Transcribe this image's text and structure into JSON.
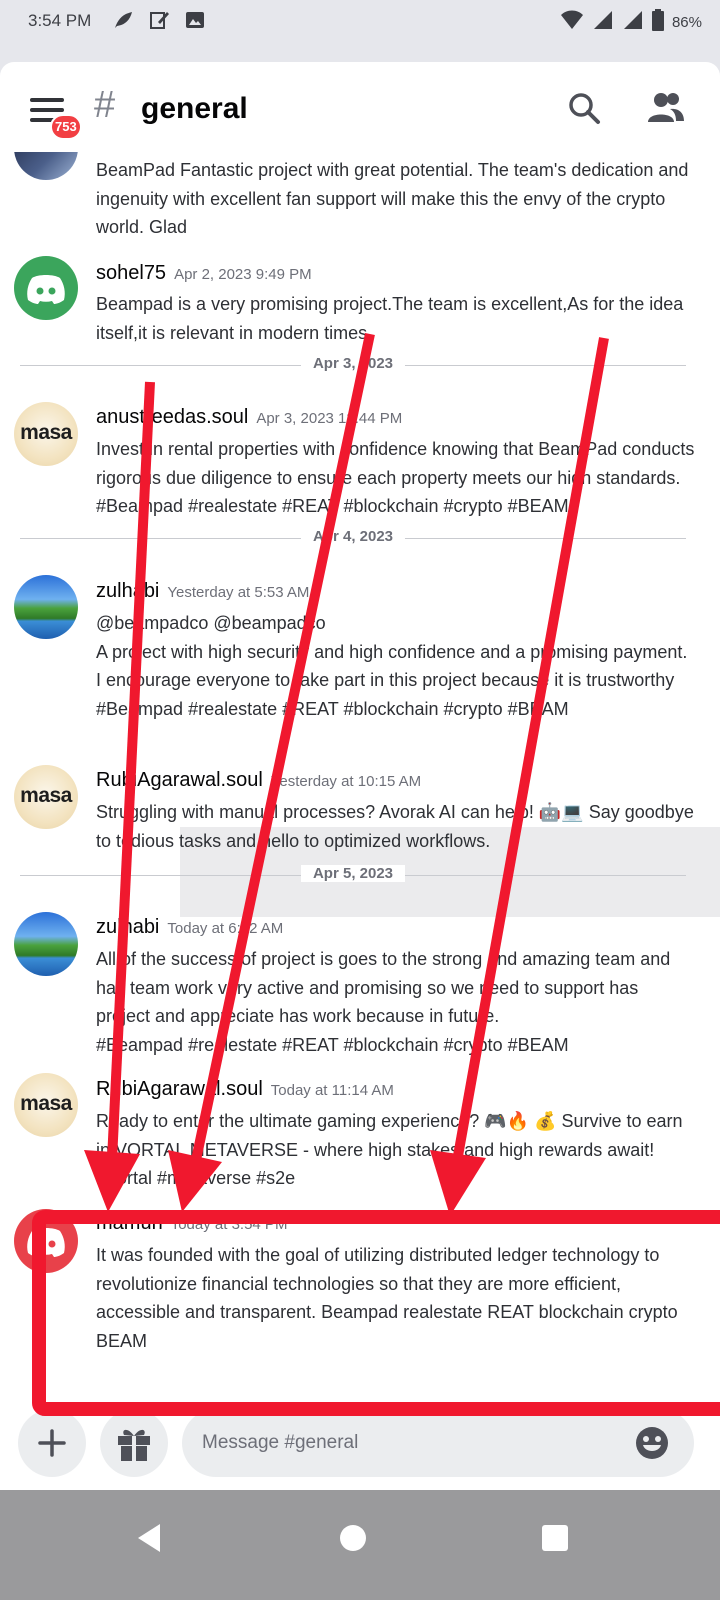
{
  "status_bar": {
    "time": "3:54 PM",
    "battery": "86%"
  },
  "header": {
    "badge_count": "753",
    "hash_symbol": "#",
    "channel_name": "general"
  },
  "messages": [
    {
      "body": "BeamPad Fantastic project with great potential. The team's dedication and ingenuity with excellent fan support will make this the envy of the crypto world. Glad"
    },
    {
      "author": "sohel75",
      "timestamp": "Apr 2, 2023 9:49 PM",
      "body": "Beampad is a very promising project.The team is excellent,As for the idea itself,it is relevant in modern times."
    },
    {
      "author": "anustreedas.soul",
      "timestamp": "Apr 3, 2023 12:44 PM",
      "body": "Invest in rental properties with confidence knowing that BeamPad conducts rigorous due diligence to ensure each property meets our high standards. #Beampad #realestate #REAT #blockchain #crypto #BEAM"
    },
    {
      "author": "zulhabi",
      "timestamp": "Yesterday at 5:53 AM",
      "body": "@beampadco @beampadco\nA project with high security and high confidence and a promising payment. I encourage everyone to take part in this project because it is trustworthy\n #Beampad #realestate #REAT #blockchain #crypto #BEAM"
    },
    {
      "author": "RubiAgarawal.soul",
      "timestamp": "Yesterday at 10:15 AM",
      "body": "Struggling with manual processes? Avorak AI can help! 🤖💻 Say goodbye to tedious tasks and hello to optimized workflows."
    },
    {
      "author": "zulhabi",
      "timestamp": "Today at 6:02 AM",
      "body": "All of the success of project is goes to the strong and amazing team and has team work very active and promising so we need to support has project and appreciate has work because in future.\n#Beampad #realestate #REAT #blockchain #crypto #BEAM"
    },
    {
      "author": "RubiAgarawal.soul",
      "timestamp": "Today at 11:14 AM",
      "body": "Ready to enter the ultimate gaming experience? 🎮🔥 💰 Survive to earn in VORTAL METAVERSE - where high stakes and high rewards await! #Vortal #metaverse #s2e"
    },
    {
      "author": "mamun",
      "timestamp": "Today at 3:54 PM",
      "body": "It was founded with the goal of utilizing distributed ledger technology to revolutionize financial technologies so that they are more efficient, accessible and transparent. Beampad realestate REAT blockchain crypto BEAM"
    }
  ],
  "dividers": [
    "Apr 3, 2023",
    "Apr 4, 2023",
    "Apr 5, 2023"
  ],
  "avatar_text": "masa",
  "composer": {
    "placeholder": "Message #general"
  },
  "colors": {
    "annotation_red": "#f0182e",
    "discord_green": "#3ba55c",
    "discord_red": "#e8414a",
    "badge_red": "#f23f43"
  }
}
